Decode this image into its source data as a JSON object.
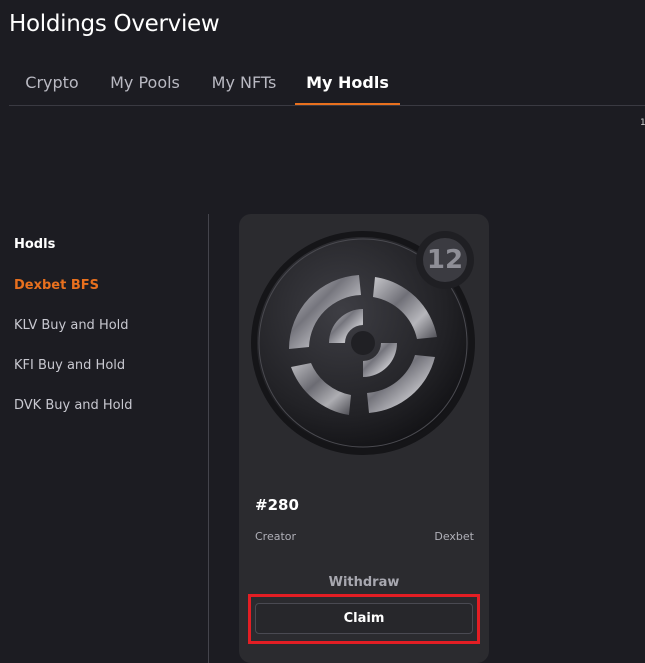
{
  "page": {
    "title": "Holdings Overview"
  },
  "tabs": [
    {
      "label": "Crypto"
    },
    {
      "label": "My Pools"
    },
    {
      "label": "My NFTs"
    },
    {
      "label": "My Hodls",
      "active": true
    }
  ],
  "sidebar": {
    "heading": "Hodls",
    "items": [
      {
        "label": "Dexbet BFS",
        "active": true
      },
      {
        "label": "KLV Buy and Hold"
      },
      {
        "label": "KFI Buy and Hold"
      },
      {
        "label": "DVK Buy and Hold"
      }
    ]
  },
  "card": {
    "badge": "12",
    "nft_id": "#280",
    "creator_label": "Creator",
    "creator_value": "Dexbet",
    "withdraw_label": "Withdraw",
    "claim_label": "Claim"
  },
  "colors": {
    "background": "#1c1c22",
    "accent": "#e8701e",
    "highlight": "#e31e24",
    "card": "#2b2b2f"
  },
  "icons": {
    "coin": "dexbet-coin-icon",
    "badge": "count-badge"
  }
}
